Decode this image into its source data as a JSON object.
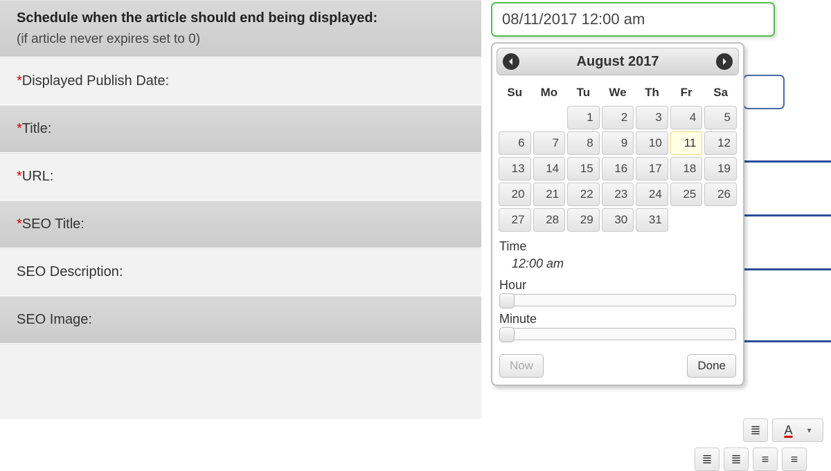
{
  "schedule": {
    "title": "Schedule when the article should end being displayed:",
    "subtitle": "(if article never expires set to 0)"
  },
  "labels": {
    "publish_date": "Displayed Publish Date:",
    "title": "Title:",
    "url": "URL:",
    "seo_title": "SEO Title:",
    "seo_desc": "SEO Description:",
    "seo_image": "SEO Image:"
  },
  "end_date_input": "08/11/2017 12:00 am",
  "datepicker": {
    "header": "August 2017",
    "dow": [
      "Su",
      "Mo",
      "Tu",
      "We",
      "Th",
      "Fr",
      "Sa"
    ],
    "leading_blanks": 2,
    "days": [
      1,
      2,
      3,
      4,
      5,
      6,
      7,
      8,
      9,
      10,
      11,
      12,
      13,
      14,
      15,
      16,
      17,
      18,
      19,
      20,
      21,
      22,
      23,
      24,
      25,
      26,
      27,
      28,
      29,
      30,
      31
    ],
    "selected": 11,
    "time_label": "Time",
    "time_value": "12:00 am",
    "hour_label": "Hour",
    "minute_label": "Minute",
    "now_label": "Now",
    "done_label": "Done"
  },
  "toolbar": {
    "align_justify": "≣",
    "font_color_glyph": "A"
  }
}
